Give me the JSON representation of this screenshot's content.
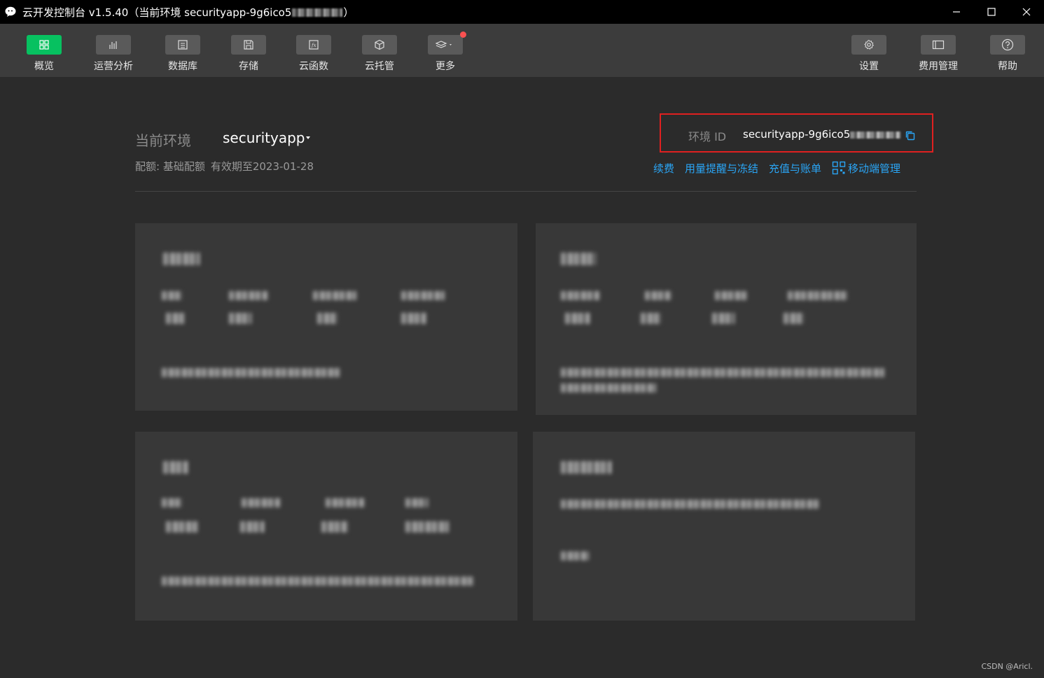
{
  "window": {
    "title": "云开发控制台 v1.5.40（当前环境 securityapp-9g6ico5",
    "title_end": "）",
    "controls": [
      "minimize-icon",
      "maximize-icon",
      "close-icon"
    ]
  },
  "toolbar": {
    "left_items": [
      {
        "label": "概览",
        "icon": "grid-icon",
        "active": true
      },
      {
        "label": "运营分析",
        "icon": "bar-chart-icon",
        "active": false
      },
      {
        "label": "数据库",
        "icon": "database-icon",
        "active": false
      },
      {
        "label": "存储",
        "icon": "save-icon",
        "active": false
      },
      {
        "label": "云函数",
        "icon": "function-icon",
        "active": false
      },
      {
        "label": "云托管",
        "icon": "cube-icon",
        "active": false
      },
      {
        "label": "更多",
        "icon": "layers-icon",
        "active": false,
        "badge": true
      }
    ],
    "right_items": [
      {
        "label": "设置",
        "icon": "gear-icon"
      },
      {
        "label": "费用管理",
        "icon": "billing-icon"
      },
      {
        "label": "帮助",
        "icon": "help-icon"
      }
    ],
    "accent_color": "#07c160",
    "badge_color": "#fa5151"
  },
  "env": {
    "label": "当前环境",
    "name": "securityapp",
    "quota_label": "配额: 基础配额",
    "validity": "有效期至2023-01-28"
  },
  "env_id": {
    "label": "环境 ID",
    "value": "securityapp-9g6ico5",
    "highlight_color": "#e02020"
  },
  "links": {
    "renew": "续费",
    "usage_alert": "用量提醒与冻结",
    "recharge": "充值与账单",
    "mobile": "移动端管理",
    "color": "#2aa5f5"
  },
  "watermark": "CSDN @Aricl."
}
